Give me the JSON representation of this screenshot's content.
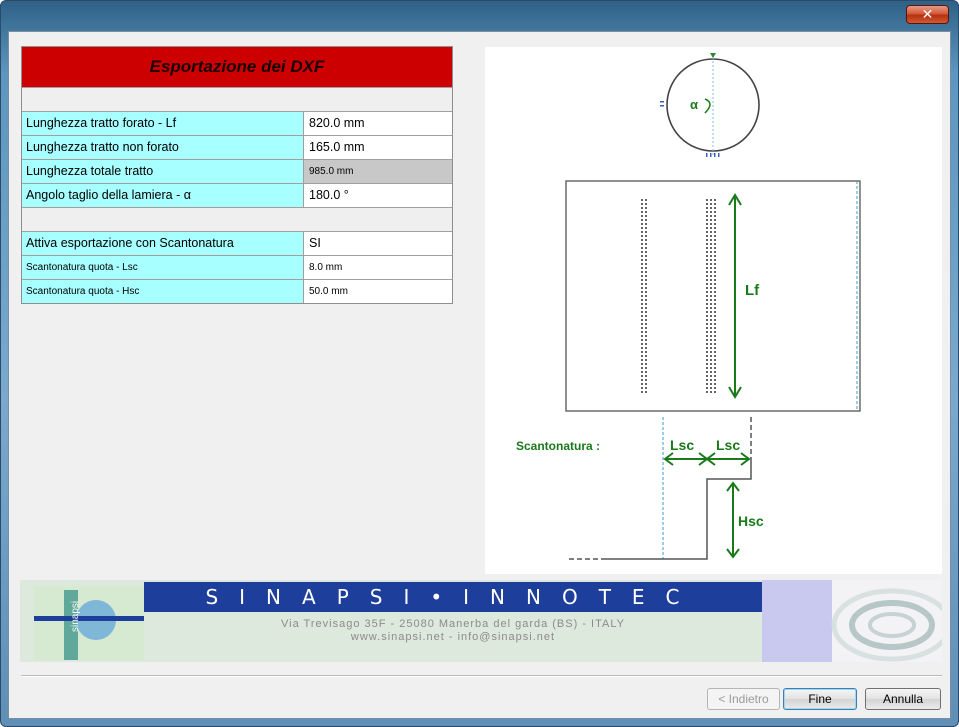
{
  "window": {
    "close_label": "✕"
  },
  "table": {
    "title": "Esportazione dei DXF",
    "rows": [
      {
        "label": "Lunghezza tratto forato - Lf",
        "value": "820.0 mm"
      },
      {
        "label": "Lunghezza tratto non forato",
        "value": "165.0 mm"
      },
      {
        "label": "Lunghezza totale tratto",
        "value": "985.0 mm"
      },
      {
        "label": "Angolo taglio della lamiera - α",
        "value": "180.0 °"
      }
    ],
    "rows2": [
      {
        "label": "Attiva esportazione con Scantonatura",
        "value": "SI"
      },
      {
        "label": "Scantonatura quota - Lsc",
        "value": "8.0 mm"
      },
      {
        "label": "Scantonatura quota - Hsc",
        "value": "50.0 mm"
      }
    ]
  },
  "drawing": {
    "alpha_label": "α",
    "lf_label": "Lf",
    "scantonatura_label": "Scantonatura :",
    "lsc_label": "Lsc",
    "hsc_label": "Hsc",
    "accent_color": "#1a7a1a"
  },
  "banner": {
    "company": "SINAPSI•INNOTEC",
    "address": "Via Trevisago 35F - 25080 Manerba del garda (BS) - ITALY",
    "web": "www.sinapsi.net - info@sinapsi.net",
    "logo_text": "sinapsi"
  },
  "buttons": {
    "back": "< Indietro",
    "finish": "Fine",
    "cancel": "Annulla"
  }
}
